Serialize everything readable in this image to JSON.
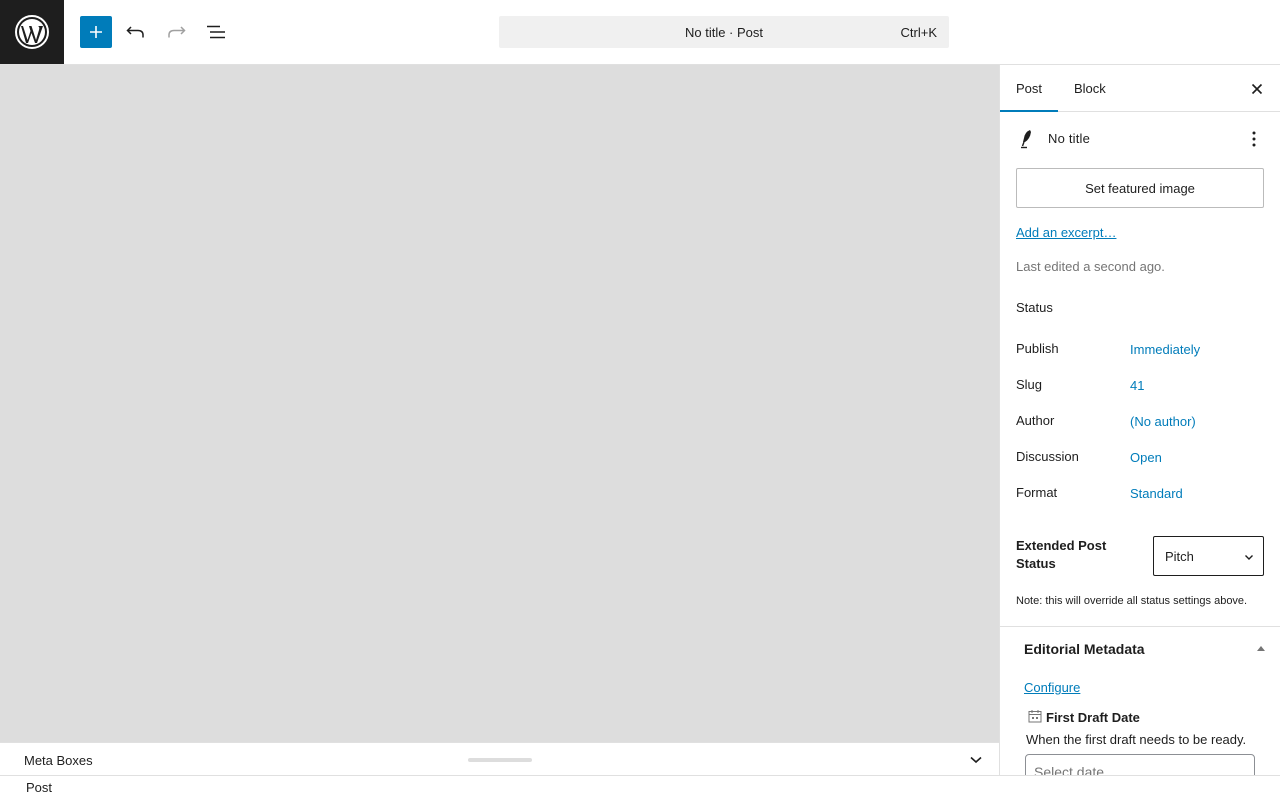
{
  "toolbar": {
    "logo_icon": "wordpress-logo",
    "add_icon": "plus-icon",
    "undo_icon": "undo-icon",
    "redo_icon": "redo-icon",
    "listview_icon": "list-view-icon",
    "command_bar": {
      "title": "No title · Post",
      "shortcut": "Ctrl+K"
    }
  },
  "meta_boxes": {
    "label": "Meta Boxes",
    "toggle_icon": "chevron-down-icon"
  },
  "footer": {
    "breadcrumb": "Post"
  },
  "sidebar": {
    "tabs": [
      {
        "label": "Post",
        "active": true
      },
      {
        "label": "Block",
        "active": false
      }
    ],
    "close_icon": "close-icon",
    "document": {
      "icon": "feather-icon",
      "title": "No title",
      "menu_icon": "more-vertical-icon"
    },
    "featured_image_button": "Set featured image",
    "excerpt_link": "Add an excerpt…",
    "last_edited": "Last edited a second ago.",
    "status_heading": "Status",
    "properties": [
      {
        "label": "Publish",
        "value": "Immediately"
      },
      {
        "label": "Slug",
        "value": "41"
      },
      {
        "label": "Author",
        "value": "(No author)"
      },
      {
        "label": "Discussion",
        "value": "Open"
      },
      {
        "label": "Format",
        "value": "Standard"
      }
    ],
    "extended_status": {
      "label": "Extended Post Status",
      "value": "Pitch",
      "note": "Note: this will override all status settings above."
    },
    "editorial_metadata": {
      "title": "Editorial Metadata",
      "toggle_icon": "triangle-up-icon",
      "configure_link": "Configure",
      "field": {
        "icon": "calendar-icon",
        "title": "First Draft Date",
        "description": "When the first draft needs to be ready.",
        "placeholder": "Select date"
      }
    }
  },
  "colors": {
    "accent": "#007cba",
    "canvas_bg": "#dddddd",
    "logo_bg": "#1e1e1e"
  }
}
